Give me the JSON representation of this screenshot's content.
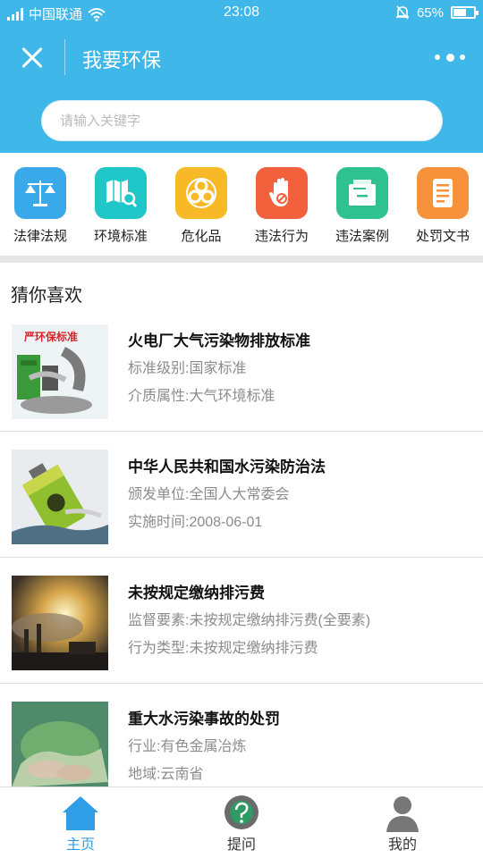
{
  "status_bar": {
    "carrier": "中国联通",
    "time": "23:08",
    "battery": "65%",
    "battery_level": 0.65
  },
  "header": {
    "title": "我要环保",
    "search_placeholder": "请输入关键字"
  },
  "categories": [
    {
      "label": "法律法规",
      "icon": "scales-icon",
      "color": "#3aa9e9"
    },
    {
      "label": "环境标准",
      "icon": "map-search-icon",
      "color": "#1fc7c9"
    },
    {
      "label": "危化品",
      "icon": "biohazard-icon",
      "color": "#f7b925"
    },
    {
      "label": "违法行为",
      "icon": "stop-hand-icon",
      "color": "#f2613b"
    },
    {
      "label": "违法案例",
      "icon": "folder-icon",
      "color": "#2fc18f"
    },
    {
      "label": "处罚文书",
      "icon": "document-icon",
      "color": "#f7923a"
    }
  ],
  "section_title": "猜你喜欢",
  "items": [
    {
      "title": "火电厂大气污染物排放标准",
      "line1": "标准级别:国家标准",
      "line2": "介质属性:大气环境标准",
      "thumb_text": "严环保标准"
    },
    {
      "title": "中华人民共和国水污染防治法",
      "line1": "颁发单位:全国人大常委会",
      "line2": "实施时间:2008-06-01"
    },
    {
      "title": "未按规定缴纳排污费",
      "line1": "监督要素:未按规定缴纳排污费(全要素)",
      "line2": "行为类型:未按规定缴纳排污费"
    },
    {
      "title": "重大水污染事故的处罚",
      "line1": "行业:有色金属冶炼",
      "line2": "地域:云南省"
    }
  ],
  "tabs": [
    {
      "label": "主页",
      "icon": "home-icon",
      "active": true
    },
    {
      "label": "提问",
      "icon": "question-icon",
      "active": false
    },
    {
      "label": "我的",
      "icon": "profile-icon",
      "active": false
    }
  ],
  "accent_color": "#3fb7e9"
}
